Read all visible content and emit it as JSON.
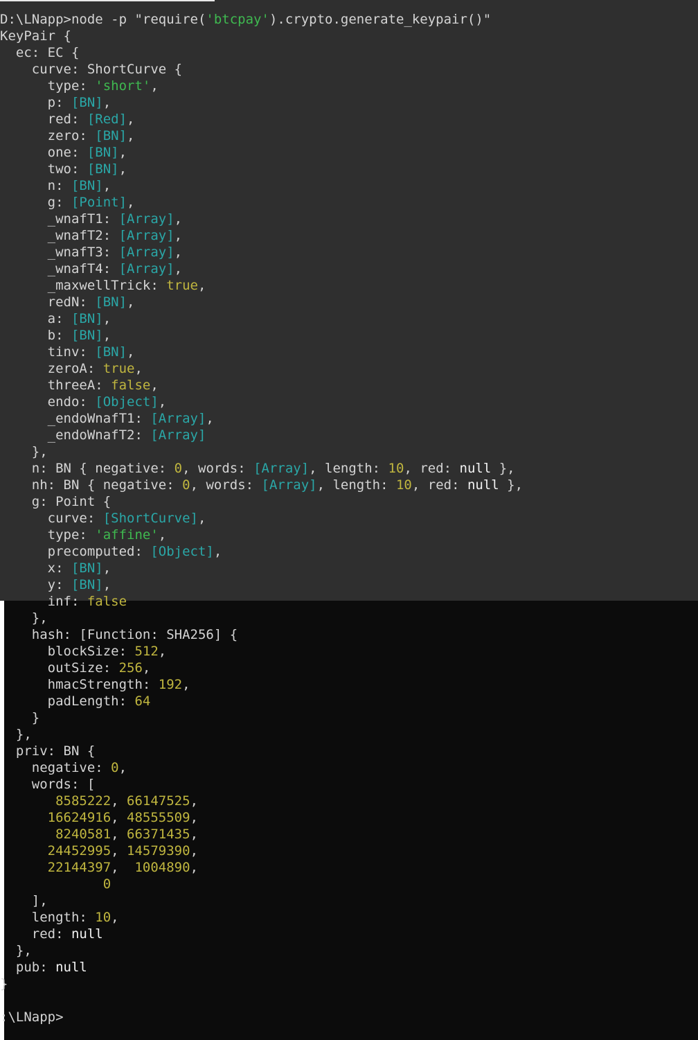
{
  "window": {
    "prompt_initial": "D:\\LNapp>",
    "command": "node -p \"require('btcpay').crypto.generate_keypair()\"",
    "prompt_final": ":\\LNapp>"
  },
  "lines": [
    {
      "text": "D:\\LNapp>node -p \"require('btcpay').crypto.generate_keypair()\""
    },
    {
      "text": "KeyPair {"
    },
    {
      "text": "  ec: EC {"
    },
    {
      "text": "    curve: ShortCurve {"
    },
    {
      "text": "      type: 'short',"
    },
    {
      "text": "      p: [BN],"
    },
    {
      "text": "      red: [Red],"
    },
    {
      "text": "      zero: [BN],"
    },
    {
      "text": "      one: [BN],"
    },
    {
      "text": "      two: [BN],"
    },
    {
      "text": "      n: [BN],"
    },
    {
      "text": "      g: [Point],"
    },
    {
      "text": "      _wnafT1: [Array],"
    },
    {
      "text": "      _wnafT2: [Array],"
    },
    {
      "text": "      _wnafT3: [Array],"
    },
    {
      "text": "      _wnafT4: [Array],"
    },
    {
      "text": "      _maxwellTrick: true,"
    },
    {
      "text": "      redN: [BN],"
    },
    {
      "text": "      a: [BN],"
    },
    {
      "text": "      b: [BN],"
    },
    {
      "text": "      tinv: [BN],"
    },
    {
      "text": "      zeroA: true,"
    },
    {
      "text": "      threeA: false,"
    },
    {
      "text": "      endo: [Object],"
    },
    {
      "text": "      _endoWnafT1: [Array],"
    },
    {
      "text": "      _endoWnafT2: [Array]"
    },
    {
      "text": "    },"
    },
    {
      "text": "    n: BN { negative: 0, words: [Array], length: 10, red: null },"
    },
    {
      "text": "    nh: BN { negative: 0, words: [Array], length: 10, red: null },"
    },
    {
      "text": "    g: Point {"
    },
    {
      "text": "      curve: [ShortCurve],"
    },
    {
      "text": "      type: 'affine',"
    },
    {
      "text": "      precomputed: [Object],"
    },
    {
      "text": "      x: [BN],"
    },
    {
      "text": "      y: [BN],"
    },
    {
      "text": "      inf: false"
    },
    {
      "text": "    },"
    },
    {
      "text": "    hash: [Function: SHA256] {"
    },
    {
      "text": "      blockSize: 512,"
    },
    {
      "text": "      outSize: 256,"
    },
    {
      "text": "      hmacStrength: 192,"
    },
    {
      "text": "      padLength: 64"
    },
    {
      "text": "    }"
    },
    {
      "text": "  },"
    },
    {
      "text": "  priv: BN {"
    },
    {
      "text": "    negative: 0,"
    },
    {
      "text": "    words: ["
    },
    {
      "text": "       8585222, 66147525,"
    },
    {
      "text": "      16624916, 48555509,"
    },
    {
      "text": "       8240581, 66371435,"
    },
    {
      "text": "      24452995, 14579390,"
    },
    {
      "text": "      22144397,  1004890,"
    },
    {
      "text": "             0"
    },
    {
      "text": "    ],"
    },
    {
      "text": "    length: 10,"
    },
    {
      "text": "    red: null"
    },
    {
      "text": "  },"
    },
    {
      "text": "  pub: null"
    },
    {
      "text": "}"
    },
    {
      "text": ""
    },
    {
      "text": ":\\LNapp>"
    }
  ],
  "colors": {
    "background_top": "#2f2f2f",
    "background_bottom": "#0c0c0c",
    "text": "#d4d4d4",
    "string": "#3fb950",
    "special": "#2aa7a7",
    "number": "#c0b63f",
    "keyword": "#c0b63f"
  }
}
